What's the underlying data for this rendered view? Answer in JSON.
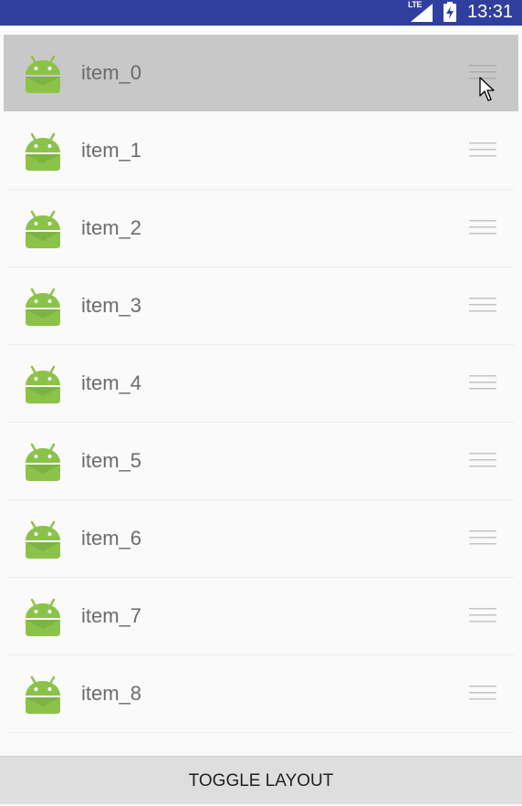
{
  "status_bar": {
    "network_label": "LTE",
    "time": "13:31"
  },
  "list": {
    "items": [
      {
        "label": "item_0",
        "icon": "android-robot-icon",
        "dragging": true
      },
      {
        "label": "item_1",
        "icon": "android-robot-icon"
      },
      {
        "label": "item_2",
        "icon": "android-robot-icon"
      },
      {
        "label": "item_3",
        "icon": "android-robot-icon"
      },
      {
        "label": "item_4",
        "icon": "android-robot-icon"
      },
      {
        "label": "item_5",
        "icon": "android-robot-icon"
      },
      {
        "label": "item_6",
        "icon": "android-robot-icon"
      },
      {
        "label": "item_7",
        "icon": "android-robot-icon"
      },
      {
        "label": "item_8",
        "icon": "android-robot-icon"
      }
    ]
  },
  "toggle_button": {
    "label": "TOGGLE LAYOUT"
  },
  "colors": {
    "status_bar": "#303f9f",
    "android_green": "#8bc34a",
    "dragged_row": "#c8c8c8"
  }
}
